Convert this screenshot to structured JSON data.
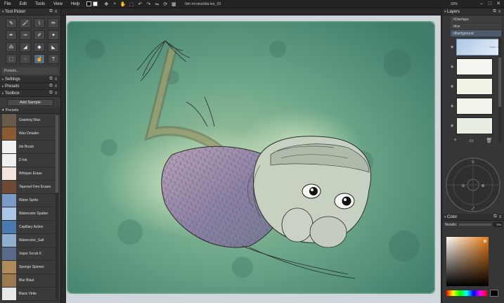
{
  "menu": {
    "items": [
      "File",
      "Edit",
      "Tools",
      "View",
      "Help"
    ],
    "document_title": "fish mi mischita kor_03",
    "zoom": "33%"
  },
  "left_panel": {
    "tool_picker_title": "Tool Picker",
    "tools": [
      "pen-icon",
      "brush-icon",
      "dropper-icon",
      "pencil-icon",
      "airbrush-icon",
      "ink-icon",
      "marker-icon",
      "wand-icon",
      "spray-icon",
      "chalk-icon",
      "fill-icon",
      "palette-knife-icon",
      "select-icon",
      "blur-icon",
      "smudge-icon",
      "text-icon"
    ],
    "presets_dropdown": "Presets...",
    "settings_title": "Settings",
    "presets_title": "Presets",
    "toolbox_title": "Toolbox",
    "add_sample_label": "Add Sample",
    "presets_sub_title": "Presets",
    "preset_items": [
      {
        "label": "Graining Wax",
        "color": "#6a5a48"
      },
      {
        "label": "Wax Detailer",
        "color": "#8a5a30"
      },
      {
        "label": "Ink Brush",
        "color": "#f0f0f0"
      },
      {
        "label": "D Ink",
        "color": "#efefef"
      },
      {
        "label": "Whisper Erase",
        "color": "#f2e6dc"
      },
      {
        "label": "Tapered Firm Eraser",
        "color": "#6e4a35"
      },
      {
        "label": "Water Spritz",
        "color": "#7a9ac8"
      },
      {
        "label": "Watercolor Spatter",
        "color": "#a8c6e6"
      },
      {
        "label": "Capillary Action",
        "color": "#4a7ab0"
      },
      {
        "label": "Watercolor_Salt",
        "color": "#90aed0"
      },
      {
        "label": "Vapor Scrub II",
        "color": "#5a6a8a"
      },
      {
        "label": "Sponge Spinner",
        "color": "#b08a5a"
      },
      {
        "label": "Blur Blast",
        "color": "#9a7a50"
      },
      {
        "label": "Basic Virtie",
        "color": "#e8e8e8"
      }
    ]
  },
  "layers_panel": {
    "title": "Layers",
    "groups": [
      ">Overlays",
      ">Kor",
      ">Background"
    ],
    "selected_layer_name": "Layer 1"
  },
  "color_panel": {
    "title": "Color",
    "metallic_label": "Metallic",
    "metallic_value": "0%",
    "accent": "#e87a12"
  }
}
